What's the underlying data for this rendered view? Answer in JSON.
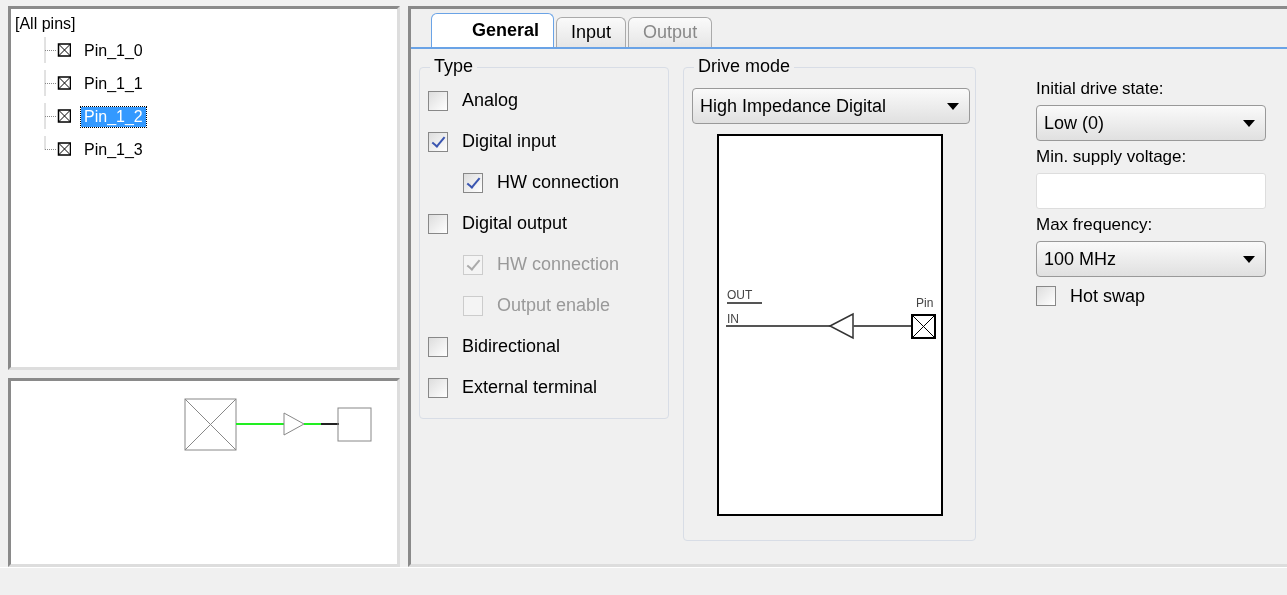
{
  "tree": {
    "root": "[All pins]",
    "items": [
      {
        "label": "Pin_1_0",
        "selected": false
      },
      {
        "label": "Pin_1_1",
        "selected": false
      },
      {
        "label": "Pin_1_2",
        "selected": true
      },
      {
        "label": "Pin_1_3",
        "selected": false
      }
    ]
  },
  "tabs": [
    {
      "label": "General",
      "selected": true,
      "disabled": false
    },
    {
      "label": "Input",
      "selected": false,
      "disabled": false
    },
    {
      "label": "Output",
      "selected": false,
      "disabled": true
    }
  ],
  "type_group": {
    "title": "Type",
    "options": [
      {
        "label": "Analog",
        "checked": false,
        "disabled": false
      },
      {
        "label": "Digital input",
        "checked": true,
        "disabled": false,
        "children": [
          {
            "label": "HW connection",
            "checked": true,
            "disabled": false
          }
        ]
      },
      {
        "label": "Digital output",
        "checked": false,
        "disabled": false,
        "children": [
          {
            "label": "HW connection",
            "checked": true,
            "disabled": true
          },
          {
            "label": "Output enable",
            "checked": false,
            "disabled": true
          }
        ]
      },
      {
        "label": "Bidirectional",
        "checked": false,
        "disabled": false
      },
      {
        "label": "External terminal",
        "checked": false,
        "disabled": false
      }
    ]
  },
  "drive_mode": {
    "title": "Drive mode",
    "value": "High Impedance Digital",
    "diagram_labels": {
      "out": "OUT",
      "in": "IN",
      "pin": "Pin"
    }
  },
  "settings": {
    "fields": [
      {
        "kind": "dropdown",
        "label": "Initial drive state:",
        "value": "Low (0)"
      },
      {
        "kind": "text",
        "label": "Min. supply voltage:"
      },
      {
        "kind": "dropdown",
        "label": "Max frequency:",
        "value": "100 MHz"
      },
      {
        "kind": "checkbox",
        "label": "Hot swap",
        "checked": false
      }
    ]
  }
}
